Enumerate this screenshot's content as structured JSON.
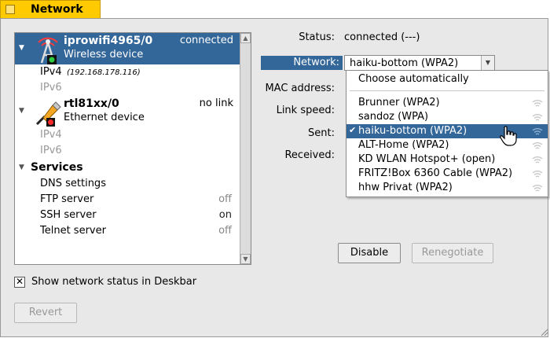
{
  "window": {
    "title": "Network"
  },
  "devices": [
    {
      "name": "iprowifi4965/0",
      "type": "Wireless device",
      "status": "connected",
      "ipv4_label": "IPv4",
      "ipv4_value": "(192.168.178.116)",
      "ipv6_label": "IPv6"
    },
    {
      "name": "rtl81xx/0",
      "type": "Ethernet device",
      "status": "no link",
      "ipv4_label": "IPv4",
      "ipv6_label": "IPv6"
    }
  ],
  "services": {
    "header": "Services",
    "items": [
      {
        "label": "DNS settings",
        "value": ""
      },
      {
        "label": "FTP server",
        "value": "off"
      },
      {
        "label": "SSH server",
        "value": "on"
      },
      {
        "label": "Telnet server",
        "value": "off"
      }
    ]
  },
  "details": {
    "status_label": "Status:",
    "status_value": "connected (---)",
    "network_label": "Network:",
    "network_selected": "haiku-bottom (WPA2)",
    "mac_label": "MAC address:",
    "link_speed_label": "Link speed:",
    "sent_label": "Sent:",
    "received_label": "Received:"
  },
  "network_menu": {
    "auto": "Choose automatically",
    "items": [
      {
        "label": "Brunner (WPA2)"
      },
      {
        "label": "sandoz (WPA)"
      },
      {
        "label": "haiku-bottom (WPA2)",
        "checked": "✔"
      },
      {
        "label": "ALT-Home (WPA2)"
      },
      {
        "label": "KD WLAN Hotspot+ (open)"
      },
      {
        "label": "FRITZ!Box 6360 Cable (WPA2)"
      },
      {
        "label": "hhw Privat (WPA2)"
      }
    ]
  },
  "buttons": {
    "disable": "Disable",
    "renegotiate": "Renegotiate",
    "revert": "Revert"
  },
  "deskbar": {
    "label": "Show network status in Deskbar",
    "checked_mark": "✕"
  },
  "colors": {
    "selection": "#336699",
    "tab": "#ffcb00",
    "background": "#e8e8e8"
  }
}
